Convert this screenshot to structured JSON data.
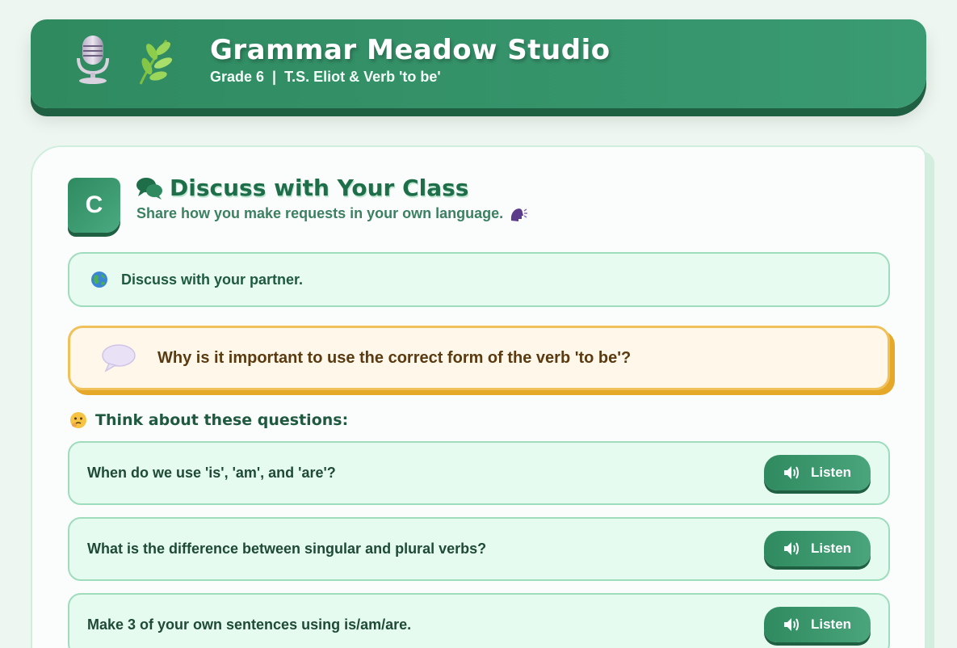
{
  "header": {
    "title": "Grammar Meadow Studio",
    "subtitle": "Grade 6  |  T.S. Eliot & Verb 'to be'",
    "icons": [
      "microphone-icon",
      "herb-icon"
    ]
  },
  "section": {
    "badge": "C",
    "title": "Discuss with Your Class",
    "subtitle": "Share how you make requests in your own language.",
    "title_icon": "speech-bubbles-icon",
    "subtitle_icon": "speaking-head-icon"
  },
  "partner": {
    "text": "Discuss with your partner.",
    "icon": "globe-icon"
  },
  "main_question": {
    "text": "Why is it important to use the correct form of the verb 'to be'?",
    "icon": "speech-balloon-icon"
  },
  "think": {
    "label": "Think about these questions:",
    "icon": "thinking-face-icon"
  },
  "questions": [
    {
      "text": "When do we use 'is', 'am', and 'are'?",
      "button": "Listen"
    },
    {
      "text": "What is the difference between singular and plural verbs?",
      "button": "Listen"
    },
    {
      "text": "Make 3 of your own sentences using is/am/are.",
      "button": "Listen"
    }
  ],
  "colors": {
    "brand_green": "#2f8a60",
    "accent_amber": "#f0c15a",
    "background": "#eef6f1"
  }
}
